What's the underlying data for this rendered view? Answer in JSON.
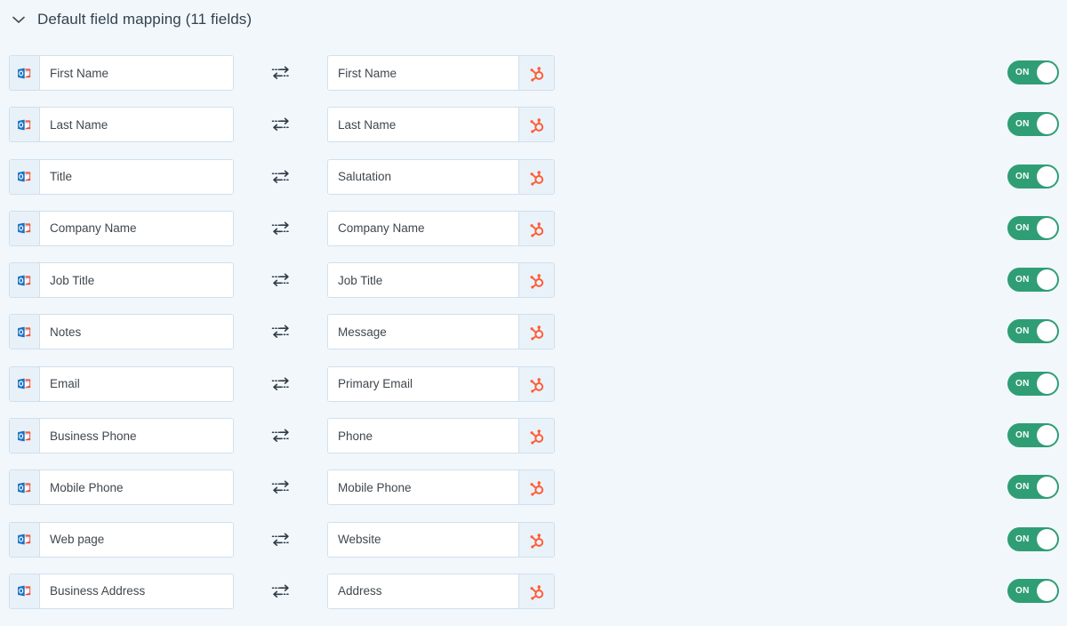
{
  "section": {
    "title": "Default field mapping (11 fields)",
    "expand_icon": "chevron-down-icon",
    "expanded": true,
    "field_count": 11
  },
  "colors": {
    "page_background": "#f2f7fb",
    "field_border": "#cfe0ee",
    "icon_cell_background": "#e9f1f8",
    "toggle_on": "#2f9e74",
    "hubspot_orange": "#FF5C35",
    "outlook_blue": "#1a6bbd",
    "outlook_red": "#eb5f4a",
    "text": "#40474d",
    "title_text": "#32434f"
  },
  "icons": {
    "source_app": "outlook-icon",
    "target_app": "hubspot-icon",
    "sync": "bidirectional-sync-arrow-icon"
  },
  "toggle": {
    "on_label": "ON"
  },
  "mappings": [
    {
      "source": "First Name",
      "target": "First Name",
      "enabled": true
    },
    {
      "source": "Last Name",
      "target": "Last Name",
      "enabled": true
    },
    {
      "source": "Title",
      "target": "Salutation",
      "enabled": true
    },
    {
      "source": "Company Name",
      "target": "Company Name",
      "enabled": true
    },
    {
      "source": "Job Title",
      "target": "Job Title",
      "enabled": true
    },
    {
      "source": "Notes",
      "target": "Message",
      "enabled": true
    },
    {
      "source": "Email",
      "target": "Primary Email",
      "enabled": true
    },
    {
      "source": "Business Phone",
      "target": "Phone",
      "enabled": true
    },
    {
      "source": "Mobile Phone",
      "target": "Mobile Phone",
      "enabled": true
    },
    {
      "source": "Web page",
      "target": "Website",
      "enabled": true
    },
    {
      "source": "Business Address",
      "target": "Address",
      "enabled": true
    }
  ]
}
